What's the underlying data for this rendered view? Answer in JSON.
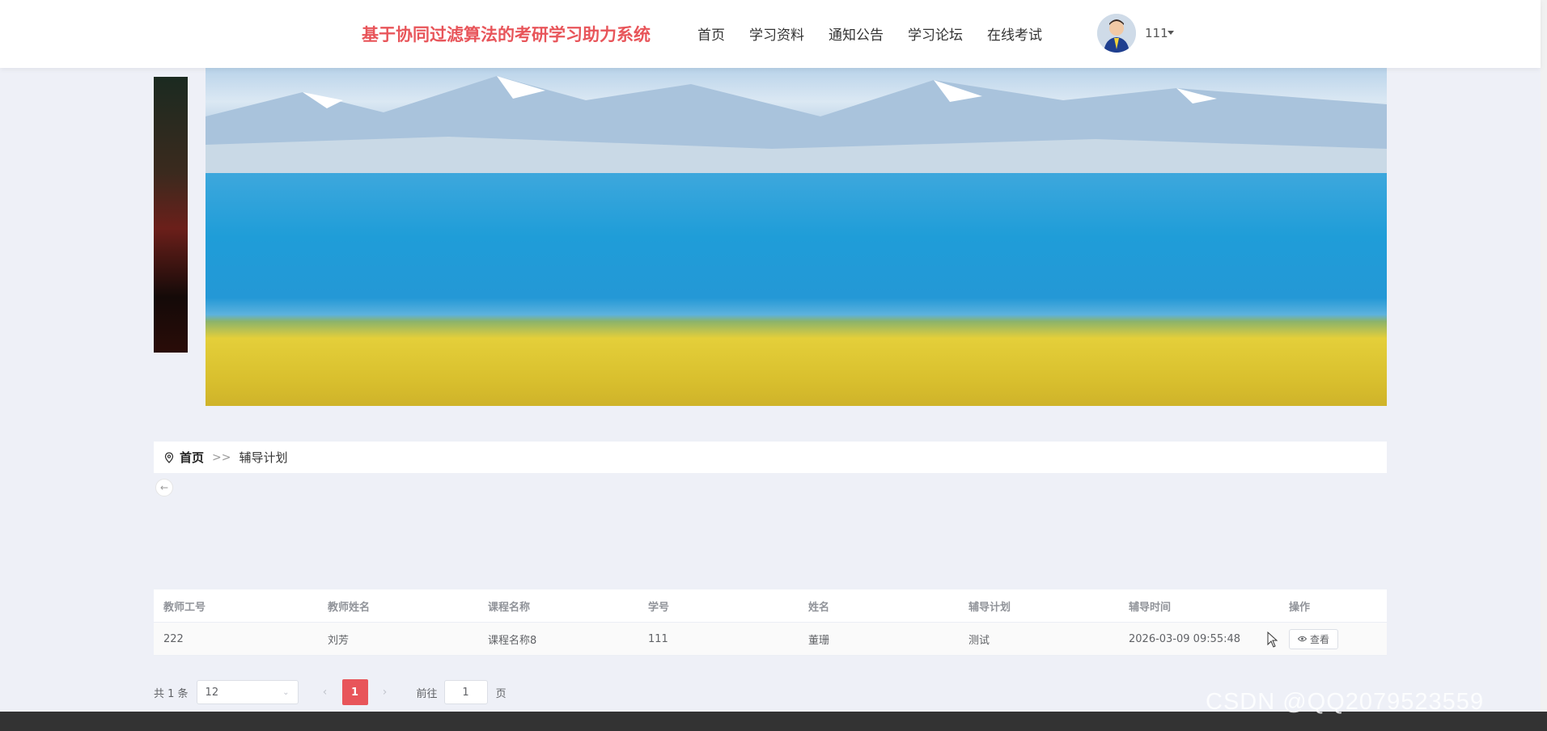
{
  "header": {
    "site_title": "基于协同过滤算法的考研学习助力系统",
    "nav": [
      "首页",
      "学习资料",
      "通知公告",
      "学习论坛",
      "在线考试"
    ],
    "user_name": "111"
  },
  "breadcrumb": {
    "home": "首页",
    "separator": ">>",
    "current": "辅导计划"
  },
  "table": {
    "headers": [
      "教师工号",
      "教师姓名",
      "课程名称",
      "学号",
      "姓名",
      "辅导计划",
      "辅导时间",
      "操作"
    ],
    "rows": [
      [
        "222",
        "刘芳",
        "课程名称8",
        "111",
        "董珊",
        "测试",
        "2026-03-09 09:55:48"
      ]
    ],
    "view_label": "查看"
  },
  "pagination": {
    "total": "共 1 条",
    "page_size": "12",
    "current_page": "1",
    "goto_label": "前往",
    "goto_value": "1",
    "goto_suffix": "页"
  },
  "watermark": "CSDN @QQ2079523559",
  "colors": {
    "accent": "#e8555a",
    "background": "#eef0f7"
  }
}
